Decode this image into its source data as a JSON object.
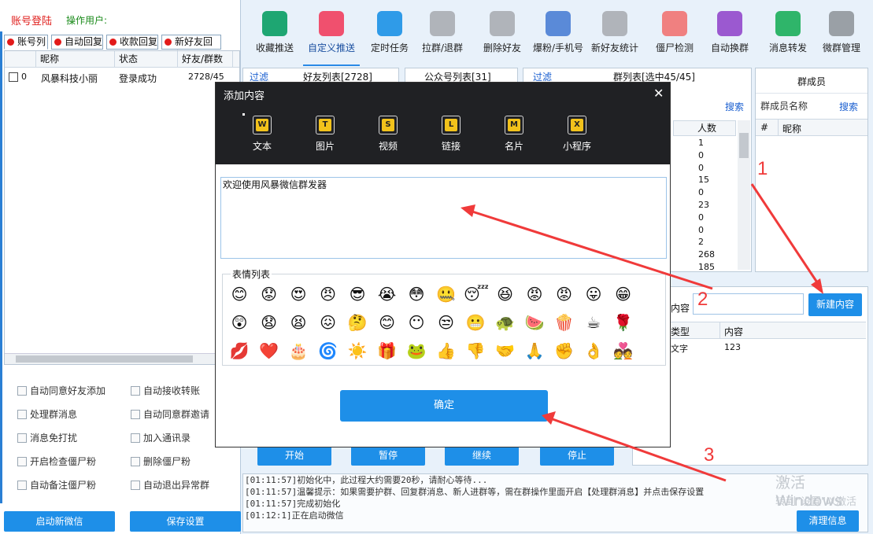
{
  "left": {
    "title": "账号登陆",
    "operator": "操作用户:",
    "tabs": [
      "账号列",
      "自动回复",
      "收款回复",
      "新好友回复"
    ],
    "columns": [
      "昵称",
      "状态",
      "好友/群数"
    ],
    "rows": [
      {
        "index": "0",
        "nickname": "风暴科技小丽",
        "status": "登录成功",
        "counts": "2728/45"
      }
    ],
    "options": [
      [
        "自动同意好友添加",
        "自动接收转账"
      ],
      [
        "处理群消息",
        "自动同意群邀请"
      ],
      [
        "消息免打扰",
        "加入通讯录"
      ],
      [
        "开启检查僵尸粉",
        "删除僵尸粉"
      ],
      [
        "自动备注僵尸粉",
        "自动退出异常群"
      ]
    ],
    "btn_start_wechat": "启动新微信",
    "btn_save": "保存设置"
  },
  "toolbar": [
    {
      "label": "收藏推送",
      "icon": "bookmark-icon",
      "color": "#1ea672"
    },
    {
      "label": "自定义推送",
      "icon": "send-icon",
      "color": "#f0506e",
      "active": true
    },
    {
      "label": "定时任务",
      "icon": "id-card-icon",
      "color": "#2f9be8"
    },
    {
      "label": "拉群/退群",
      "icon": "users-icon",
      "color": "#b0b4ba"
    },
    {
      "label": "删除好友",
      "icon": "user-remove-icon",
      "color": "#b0b4ba"
    },
    {
      "label": "爆粉/手机号",
      "icon": "user-phone-icon",
      "color": "#5a8ad8"
    },
    {
      "label": "新好友统计",
      "icon": "user-stat-icon",
      "color": "#b0b4ba"
    },
    {
      "label": "僵尸检测",
      "icon": "zombie-face-icon",
      "color": "#f08080"
    },
    {
      "label": "自动换群",
      "icon": "swap-icon",
      "color": "#9b59d0"
    },
    {
      "label": "消息转发",
      "icon": "forward-icon",
      "color": "#2fb56a"
    },
    {
      "label": "微群管理",
      "icon": "gear-icon",
      "color": "#9aa0a6"
    }
  ],
  "middle": {
    "filter1": "过滤",
    "friends_list": "好友列表[2728]",
    "public_list": "公众号列表[31]",
    "filter2": "过滤",
    "group_list": "群列表[选中45/45]",
    "search": "搜索",
    "count_header": "人数",
    "counts": [
      "1",
      "0",
      "0",
      "15",
      "0",
      "23",
      "0",
      "0",
      "2",
      "268",
      "185"
    ],
    "members_title": "群成员",
    "members_name_label": "群成员名称",
    "members_search": "搜索",
    "members_cols": [
      "#",
      "昵称"
    ],
    "content_label": "内容",
    "new_content_btn": "新建内容",
    "content_cols": [
      "类型",
      "内容"
    ],
    "content_rows": [
      {
        "type": "文字",
        "content": "123"
      }
    ],
    "controls": [
      "开始",
      "暂停",
      "继续",
      "停止"
    ],
    "logs": [
      "[01:11:57]初始化中，此过程大约需要20秒，请耐心等待...",
      "[01:11:57]温馨提示：如果需要护群、回复群消息、新人进群等，需在群操作里面开启【处理群消息】并点击保存设置",
      "[01:11:57]完成初始化",
      "[01:12:1]正在启动微信"
    ],
    "clear_btn": "清理信息",
    "activate_line1": "激活 Windows",
    "activate_line2": "转到\"设置\"以激活"
  },
  "modal": {
    "title": "添加内容",
    "types": [
      {
        "letter": "W",
        "label": "文本"
      },
      {
        "letter": "T",
        "label": "图片"
      },
      {
        "letter": "S",
        "label": "视频"
      },
      {
        "letter": "L",
        "label": "链接"
      },
      {
        "letter": "M",
        "label": "名片"
      },
      {
        "letter": "X",
        "label": "小程序"
      }
    ],
    "text_value": "欢迎使用风暴微信群发器",
    "emoji_legend": "表情列表",
    "emojis": [
      "😊",
      "😟",
      "😍",
      "😠",
      "😎",
      "😭",
      "😳",
      "🤐",
      "😴",
      "😆",
      "😡",
      "😡",
      "😛",
      "😁",
      "😲",
      "😧",
      "😫",
      "😖",
      "🤔",
      "😊",
      "😶",
      "😒",
      "😬",
      "🐢",
      "🍉",
      "🍿",
      "☕",
      "🌹",
      "💋",
      "❤️",
      "🎂",
      "🌀",
      "☀️",
      "🎁",
      "🐸",
      "👍",
      "👎",
      "🤝",
      "🙏",
      "✊",
      "👌",
      "💑"
    ],
    "confirm": "确定"
  },
  "annotations": [
    "1",
    "2",
    "3"
  ]
}
